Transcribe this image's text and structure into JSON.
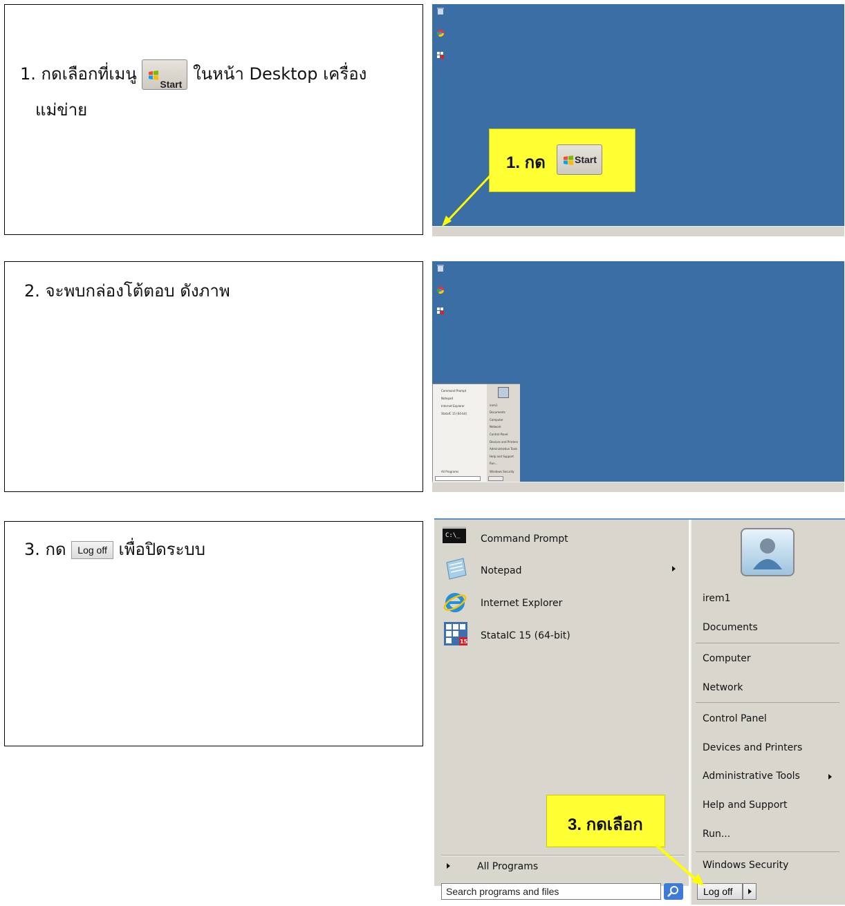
{
  "steps": [
    {
      "line1_prefix": "1. กดเลือกที่เมนู",
      "line1_suffix": "ในหน้า Desktop เครื่อง",
      "line2": "แม่ข่าย"
    },
    {
      "text": "2. จะพบกล่องโต้ตอบ ดังภาพ"
    },
    {
      "prefix": "3. กด",
      "suffix": "เพื่อปิดระบบ"
    }
  ],
  "start_label": "Start",
  "logoff_label": "Log off",
  "callouts": {
    "step1": "1. กด",
    "step3": "3. กดเลือก"
  },
  "start_menu": {
    "programs": [
      "Command Prompt",
      "Notepad",
      "Internet Explorer",
      "StataIC 15 (64-bit)"
    ],
    "stata_badge": "15",
    "right_items": [
      "irem1",
      "Documents",
      "Computer",
      "Network",
      "Control Panel",
      "Devices and Printers",
      "Administrative Tools",
      "Help and Support",
      "Run...",
      "Windows Security"
    ],
    "all_programs": "All Programs",
    "search_placeholder": "Search programs and files",
    "logoff": "Log off"
  },
  "colors": {
    "desktop": "#3a6ea5",
    "callout": "#ffff33",
    "arrow": "#ffff00",
    "menu_bg": "#d9d6ce"
  }
}
